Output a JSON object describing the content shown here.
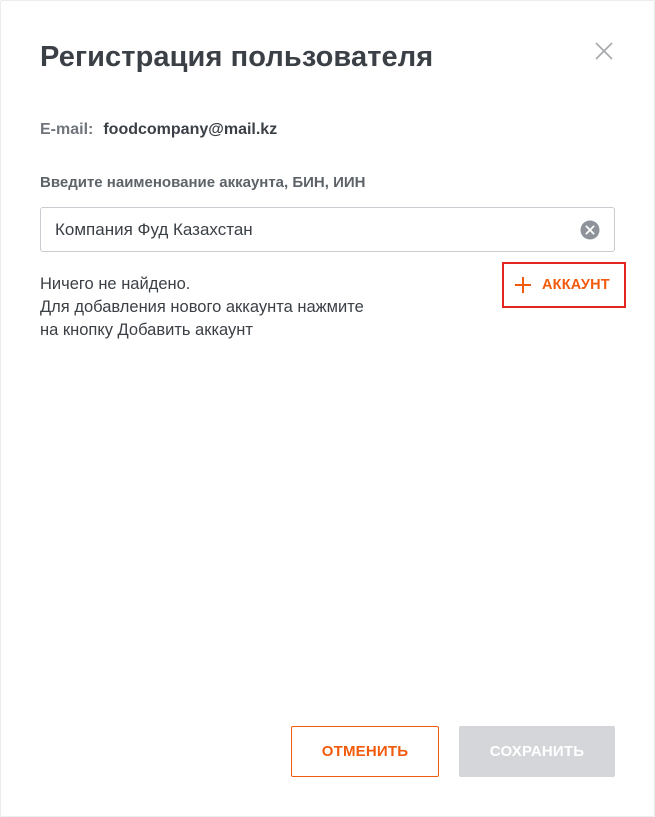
{
  "dialog": {
    "title": "Регистрация пользователя"
  },
  "email": {
    "label": "E-mail:",
    "value": "foodcompany@mail.kz"
  },
  "account_search": {
    "label": "Введите наименование аккаунта, БИН, ИИН",
    "value": "Компания Фуд Казахстан"
  },
  "result": {
    "lines": [
      "Ничего не найдено.",
      "Для добавления нового аккаунта нажмите",
      "на кнопку Добавить аккаунт"
    ]
  },
  "add_account": {
    "label": "АККАУНТ",
    "icon": "plus-icon"
  },
  "footer": {
    "cancel_label": "ОТМЕНИТЬ",
    "save_label": "СОХРАНИТЬ"
  },
  "colors": {
    "accent": "#f25a0c",
    "highlight_border": "#e0261f",
    "disabled": "#d4d6d9",
    "text": "#3b4046"
  }
}
